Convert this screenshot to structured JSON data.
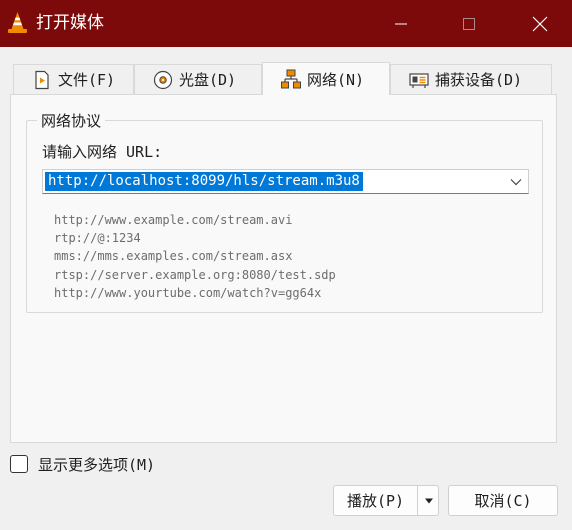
{
  "window": {
    "title": "打开媒体",
    "controls": {
      "minimize": "minimize-icon",
      "maximize": "maximize-icon",
      "close": "close-icon"
    }
  },
  "tabs": [
    {
      "label": "文件(F)",
      "icon": "file-play-icon",
      "active": false
    },
    {
      "label": "光盘(D)",
      "icon": "disc-icon",
      "active": false
    },
    {
      "label": "网络(N)",
      "icon": "network-icon",
      "active": true
    },
    {
      "label": "捕获设备(D)",
      "icon": "capture-card-icon",
      "active": false
    }
  ],
  "network": {
    "group_title": "网络协议",
    "url_label": "请输入网络 URL:",
    "url_value": "http://localhost:8099/hls/stream.m3u8",
    "examples": [
      "http://www.example.com/stream.avi",
      "rtp://@:1234",
      "mms://mms.examples.com/stream.asx",
      "rtsp://server.example.org:8080/test.sdp",
      "http://www.yourtube.com/watch?v=gg64x"
    ]
  },
  "options": {
    "show_more_label": "显示更多选项(M)",
    "show_more_checked": false
  },
  "buttons": {
    "play": "播放(P)",
    "cancel": "取消(C)"
  },
  "colors": {
    "titlebar": "#7c0a0a",
    "selection": "#0078d7",
    "vlc_orange": "#f28a00"
  }
}
